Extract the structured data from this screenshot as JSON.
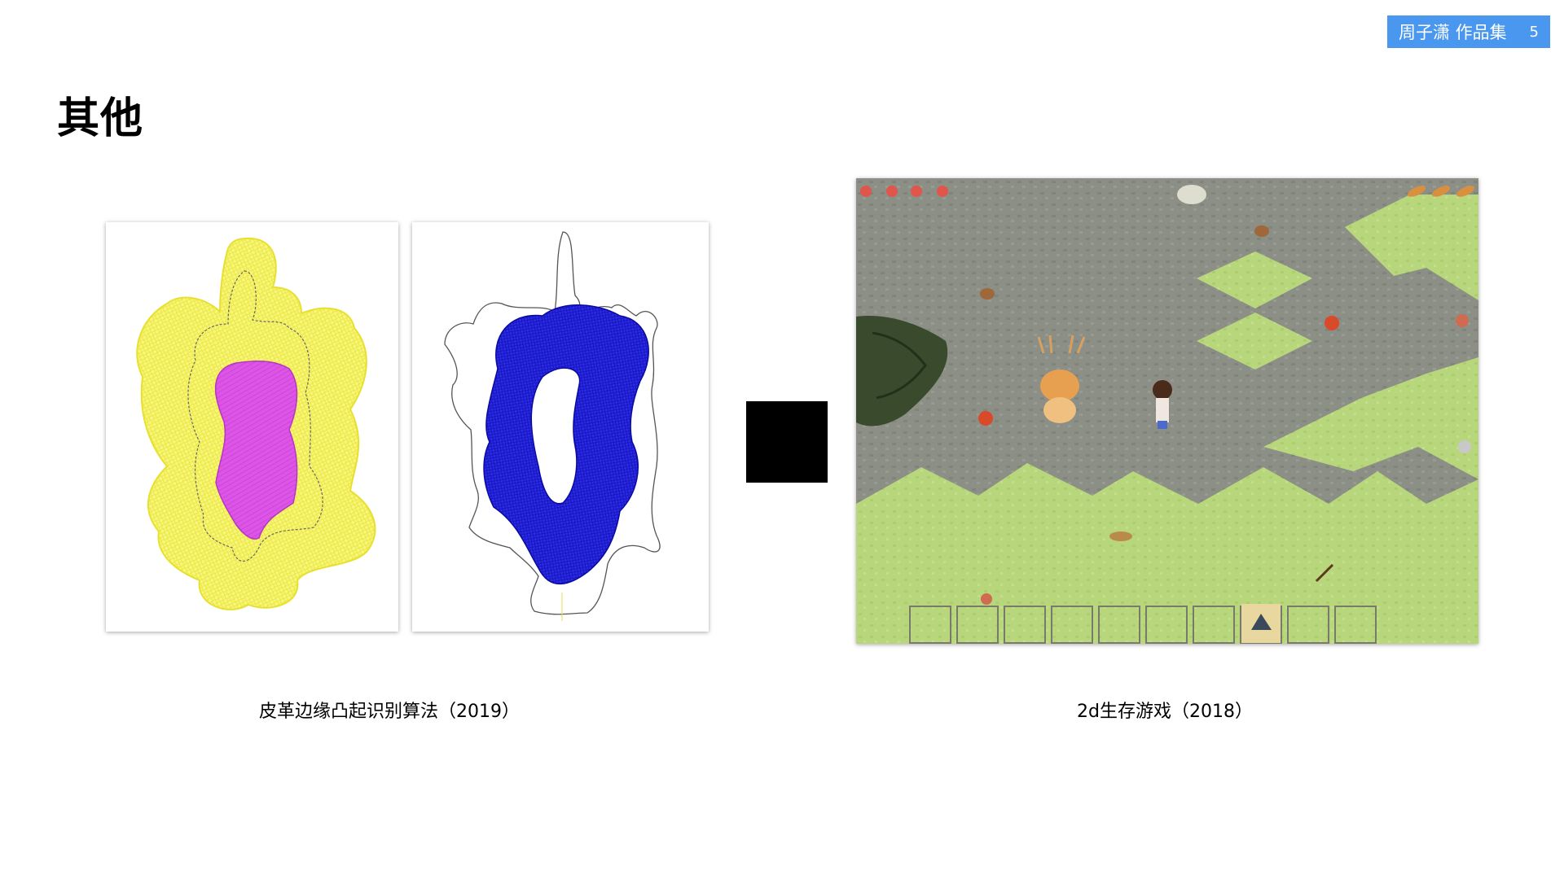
{
  "header": {
    "author_label": "周子潇 作品集",
    "page_number": "5"
  },
  "slide": {
    "title": "其他"
  },
  "projects": [
    {
      "caption": "皮革边缘凸起识别算法（2019）"
    },
    {
      "caption": "2d生存游戏（2018）"
    }
  ],
  "colors": {
    "badge_bg": "#4a97f0",
    "yellow_fill": "#f5f46a",
    "magenta_fill": "#d94ae0",
    "blue_fill": "#1a1ae0",
    "stone_gray": "#8a8f85",
    "grass_green": "#b5d67a"
  }
}
